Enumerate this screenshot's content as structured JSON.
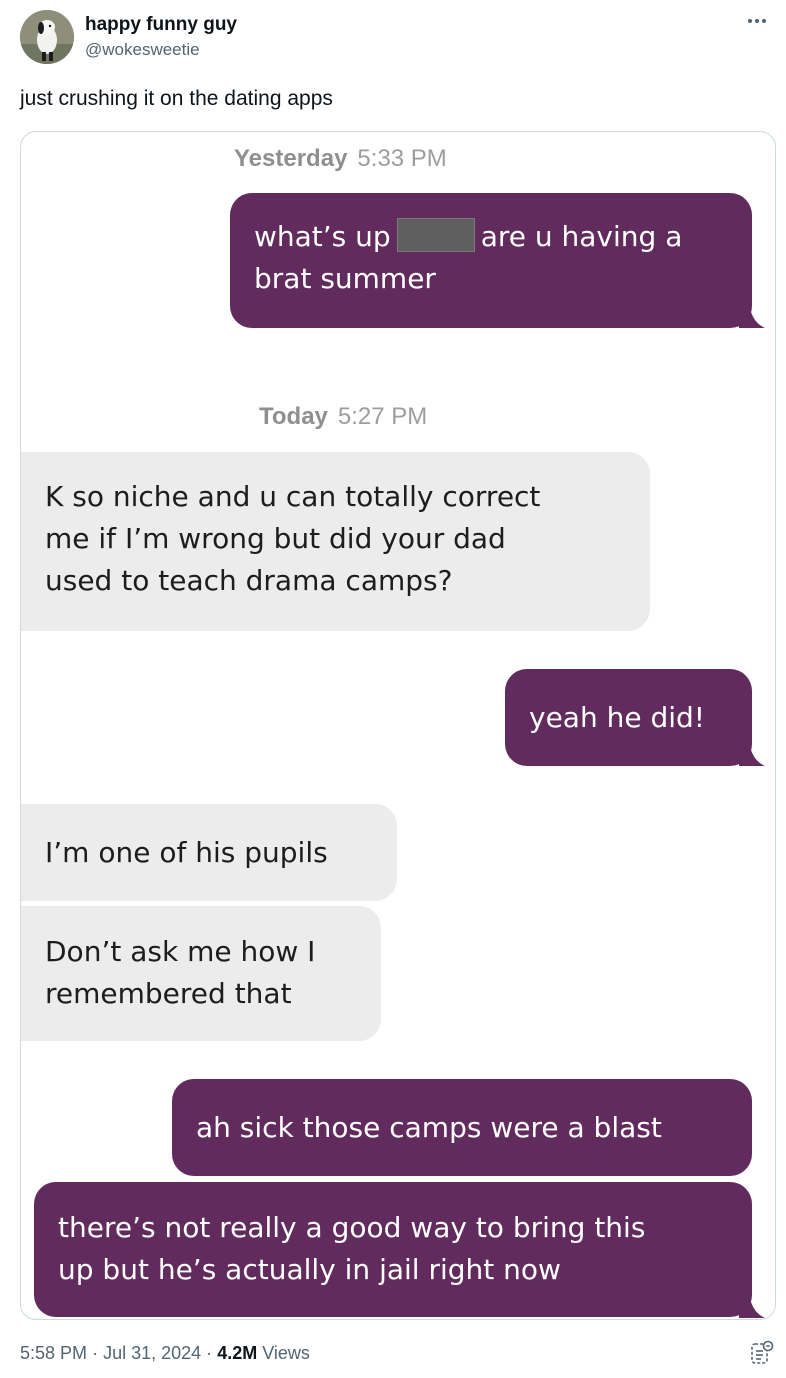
{
  "author": {
    "display_name": "happy funny guy",
    "handle": "@wokesweetie"
  },
  "tweet_text": "just crushing it on the dating apps",
  "screenshot": {
    "timestamp_1": {
      "day": "Yesterday",
      "time": "5:33 PM"
    },
    "timestamp_2": {
      "day": "Today",
      "time": "5:27 PM"
    },
    "messages": [
      {
        "direction": "outgoing",
        "text_before_redaction": "what’s up",
        "text_after_redaction": "are u having a",
        "line2": "brat summer"
      },
      {
        "direction": "incoming",
        "line1": "K so niche and u can totally correct",
        "line2": "me if I’m wrong but did your dad",
        "line3": "used to teach drama camps?"
      },
      {
        "direction": "outgoing",
        "line1": "yeah he did!"
      },
      {
        "direction": "incoming",
        "line1": "I’m one of his pupils"
      },
      {
        "direction": "incoming",
        "line1": "Don’t ask me how I",
        "line2": "remembered that"
      },
      {
        "direction": "outgoing",
        "line1": "ah sick those camps were a blast"
      },
      {
        "direction": "outgoing",
        "line1": "there’s not really a good way to bring this",
        "line2": "up but he’s actually in jail right now"
      }
    ],
    "colors": {
      "outgoing_bubble": "#622b5d",
      "incoming_bubble": "#ececec",
      "timestamp": "#9d9d9d"
    }
  },
  "footer": {
    "time": "5:58 PM",
    "separator": "·",
    "date": "Jul 31, 2024",
    "views_count": "4.2M",
    "views_label": "Views"
  },
  "icons": [
    "more-icon",
    "analytics-icon"
  ]
}
